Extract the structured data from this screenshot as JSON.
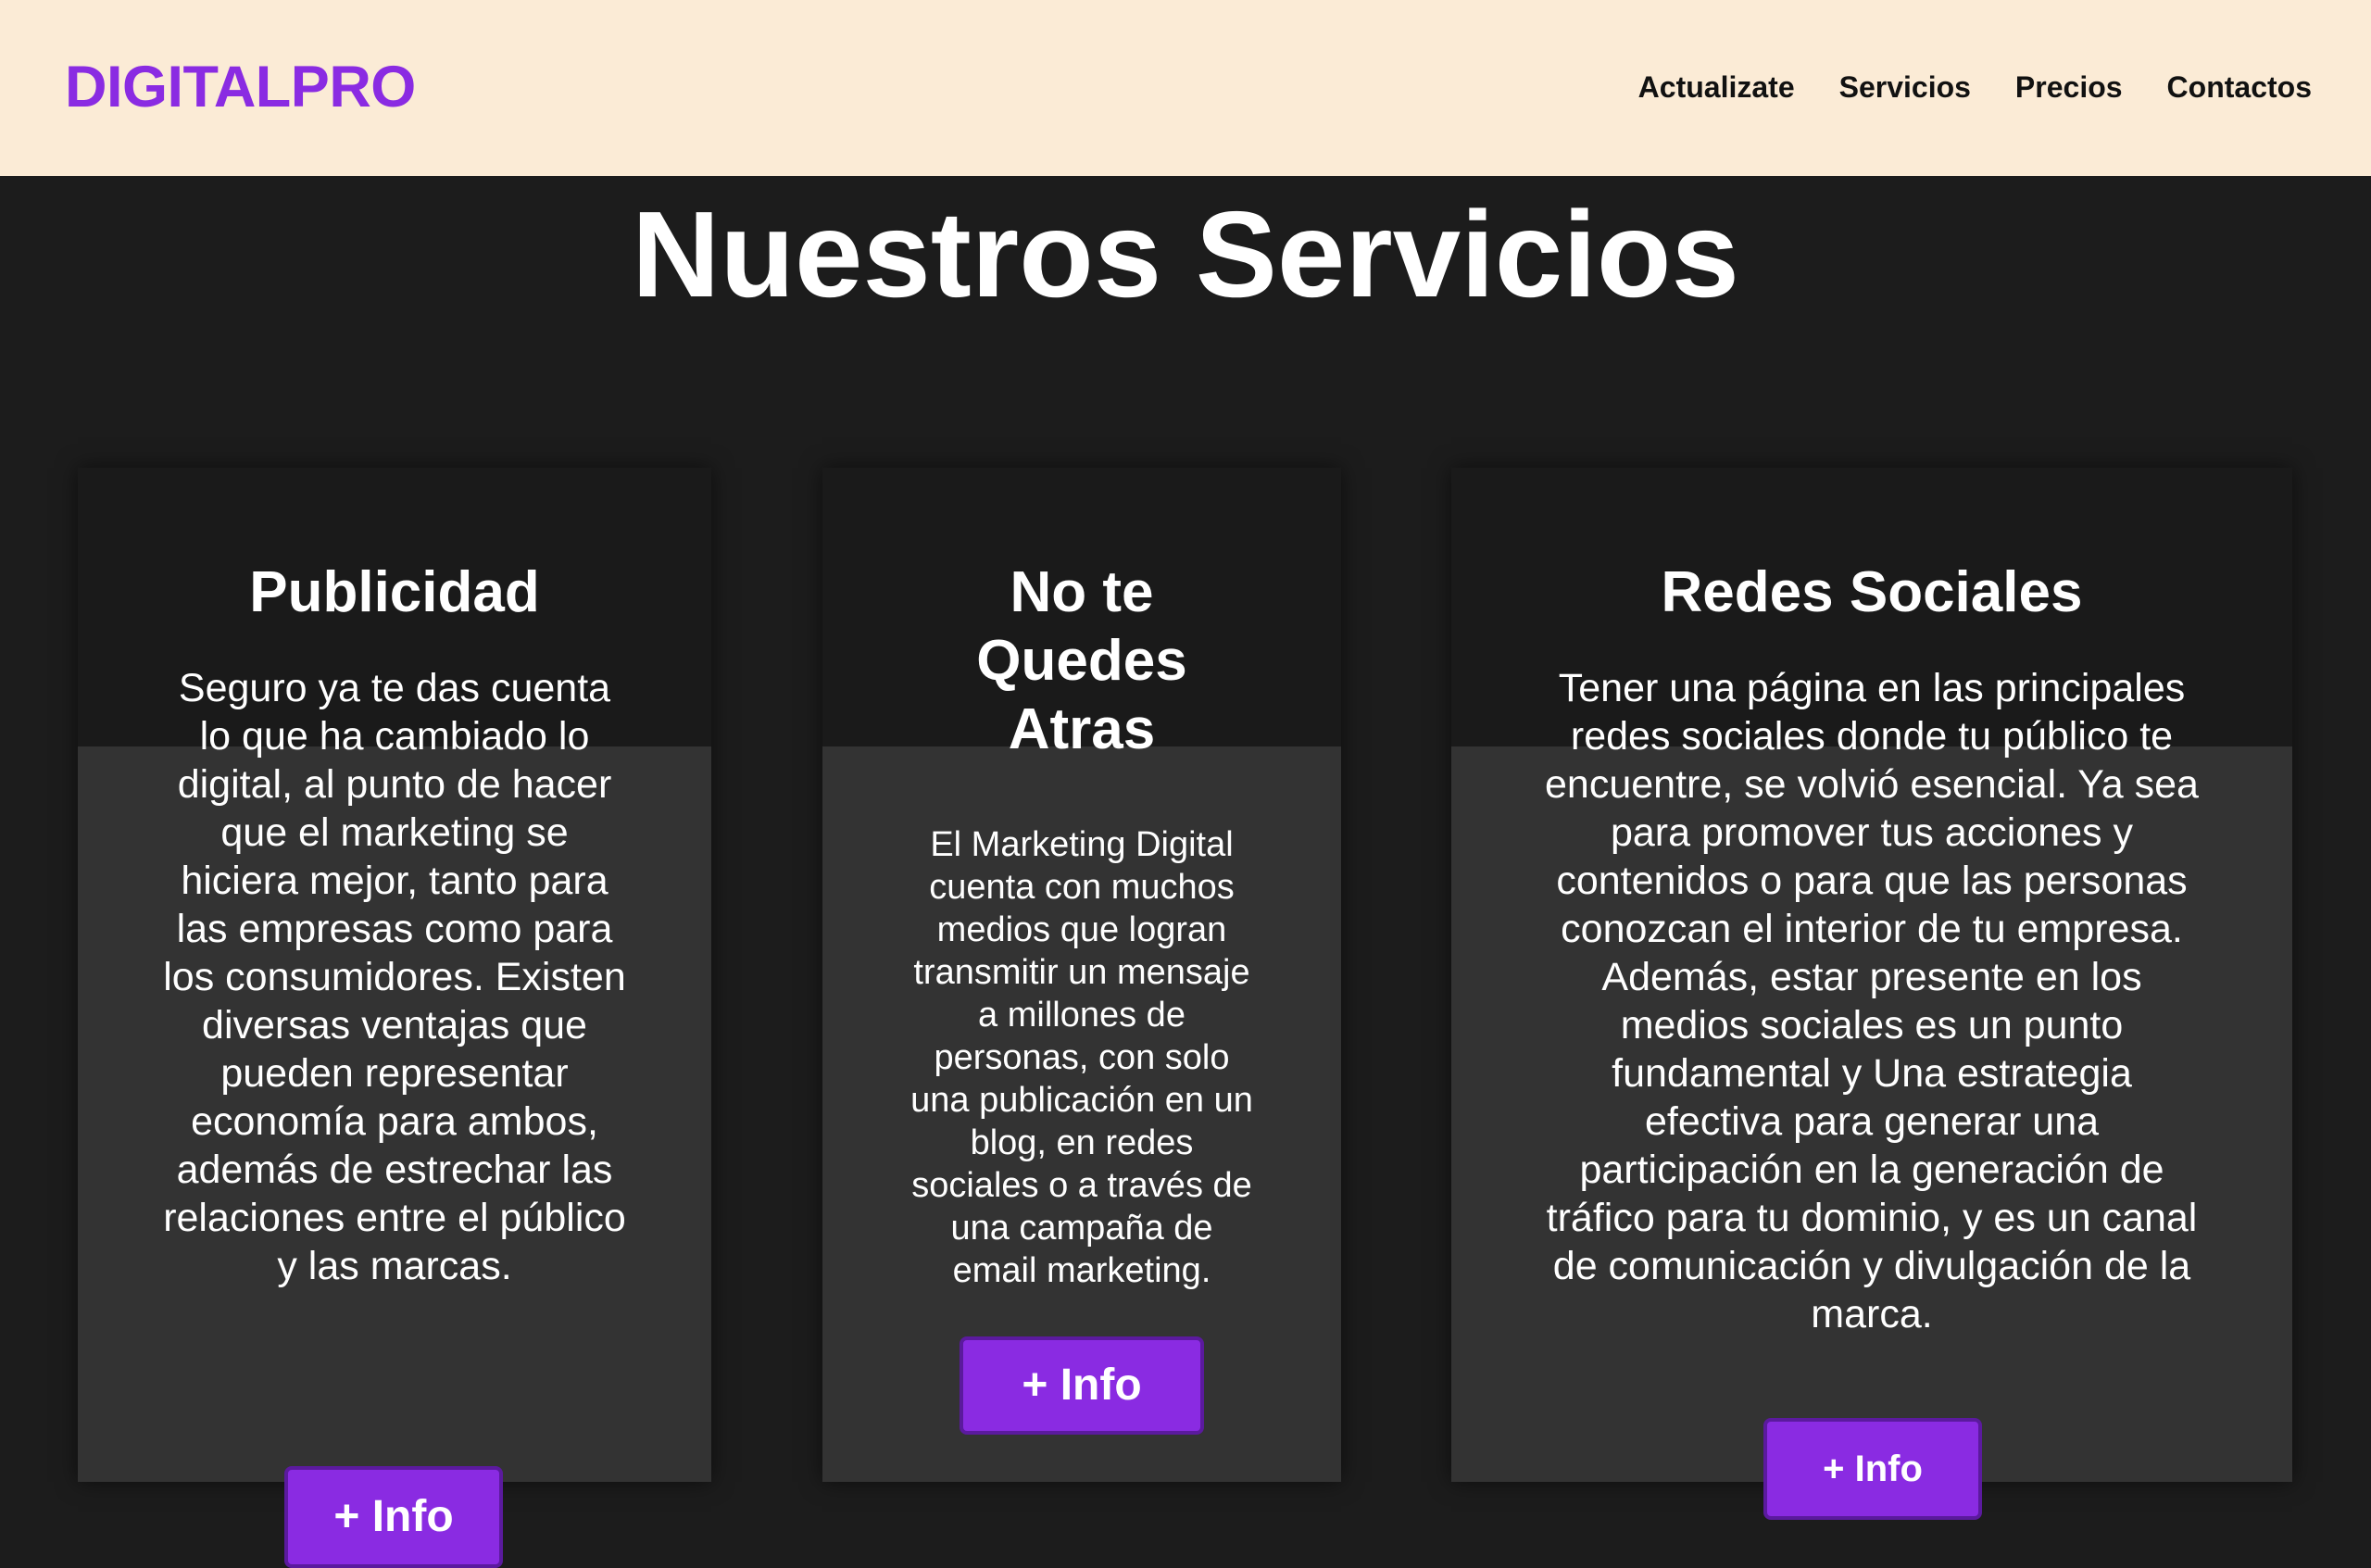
{
  "header": {
    "logo": "DIGITALPRO",
    "nav": [
      {
        "label": "Actualizate"
      },
      {
        "label": "Servicios"
      },
      {
        "label": "Precios"
      },
      {
        "label": "Contactos"
      }
    ]
  },
  "main": {
    "title": "Nuestros Servicios",
    "cards": [
      {
        "title": "Publicidad",
        "text": "Seguro ya te das cuenta lo que ha cambiado lo digital, al punto de hacer que el marketing se hiciera mejor, tanto para las empresas como para los consumidores. Existen diversas ventajas que pueden representar economía para ambos, además de estrechar las relaciones entre el público y las marcas.",
        "button": "+ Info"
      },
      {
        "title": "No te Quedes Atras",
        "text": "El Marketing Digital cuenta con muchos medios que logran transmitir un mensaje a millones de personas, con solo una publicación en un blog, en redes sociales o a través de una campaña de email marketing.",
        "button": "+ Info"
      },
      {
        "title": "Redes Sociales",
        "text": "Tener una página en las principales redes sociales donde tu público te encuentre, se volvió esencial. Ya sea para promover tus acciones y contenidos o para que las personas conozcan el interior de tu empresa. Además, estar presente en los medios sociales es un punto fundamental y Una estrategia efectiva para generar una participación en la generación de tráfico para tu dominio, y es un canal de comunicación y divulgación de la marca.",
        "button": "+ Info"
      }
    ]
  },
  "colors": {
    "brand": "#8a2be2",
    "header_bg": "#fbebd6",
    "page_bg": "#1c1c1c",
    "card_bg": "#333333"
  }
}
